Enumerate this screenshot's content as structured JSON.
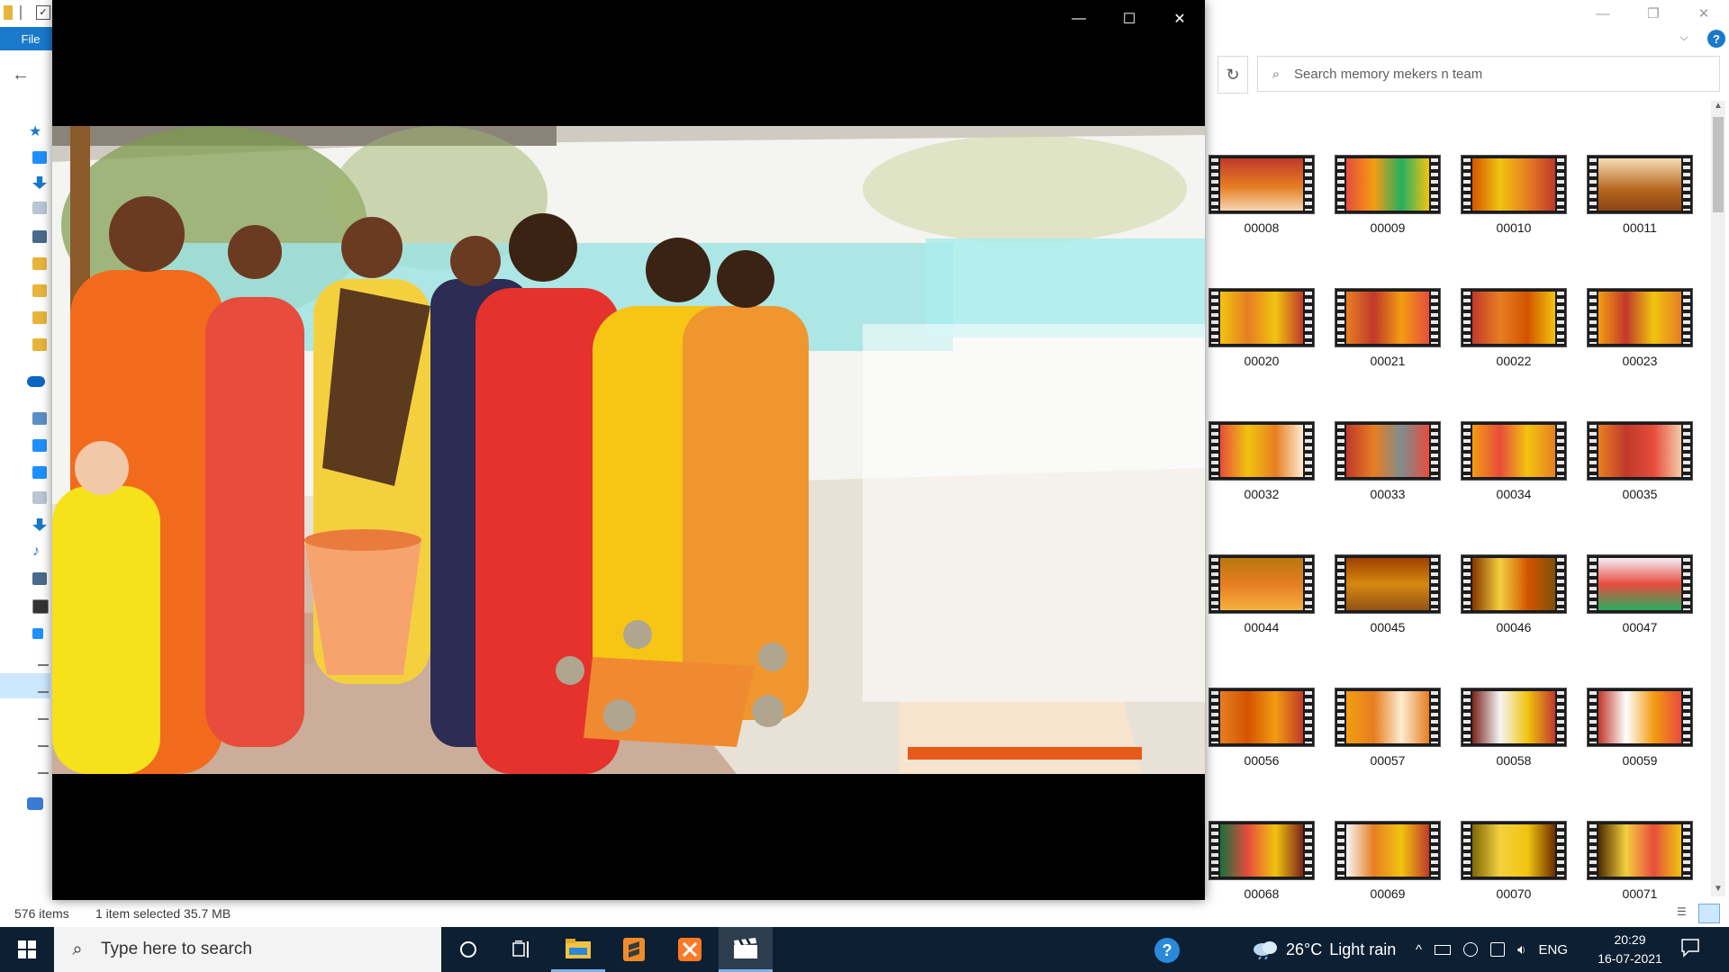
{
  "explorer": {
    "ribbon": {
      "file_tab": "File"
    },
    "search": {
      "placeholder": "Search memory mekers n team"
    },
    "status": {
      "item_count": "576 items",
      "selection": "1 item selected  35.7 MB"
    },
    "thumbnails": [
      {
        "label": "00008"
      },
      {
        "label": "00009"
      },
      {
        "label": "00010"
      },
      {
        "label": "00011"
      },
      {
        "label": "00020"
      },
      {
        "label": "00021"
      },
      {
        "label": "00022"
      },
      {
        "label": "00023"
      },
      {
        "label": "00032"
      },
      {
        "label": "00033"
      },
      {
        "label": "00034"
      },
      {
        "label": "00035"
      },
      {
        "label": "00044"
      },
      {
        "label": "00045"
      },
      {
        "label": "00046"
      },
      {
        "label": "00047"
      },
      {
        "label": "00056"
      },
      {
        "label": "00057"
      },
      {
        "label": "00058"
      },
      {
        "label": "00059"
      },
      {
        "label": "00068"
      },
      {
        "label": "00069"
      },
      {
        "label": "00070"
      },
      {
        "label": "00071"
      }
    ]
  },
  "player": {
    "controls": [
      "minimize-icon",
      "maximize-icon",
      "close-icon"
    ]
  },
  "taskbar": {
    "search_placeholder": "Type here to search",
    "weather": {
      "temperature": "26°C",
      "condition": "Light rain"
    },
    "language": "ENG",
    "time": "20:29",
    "date": "16-07-2021"
  },
  "colors": {
    "accent": "#1979ca",
    "taskbar": "#0c1f33",
    "selection": "#cce8ff"
  }
}
